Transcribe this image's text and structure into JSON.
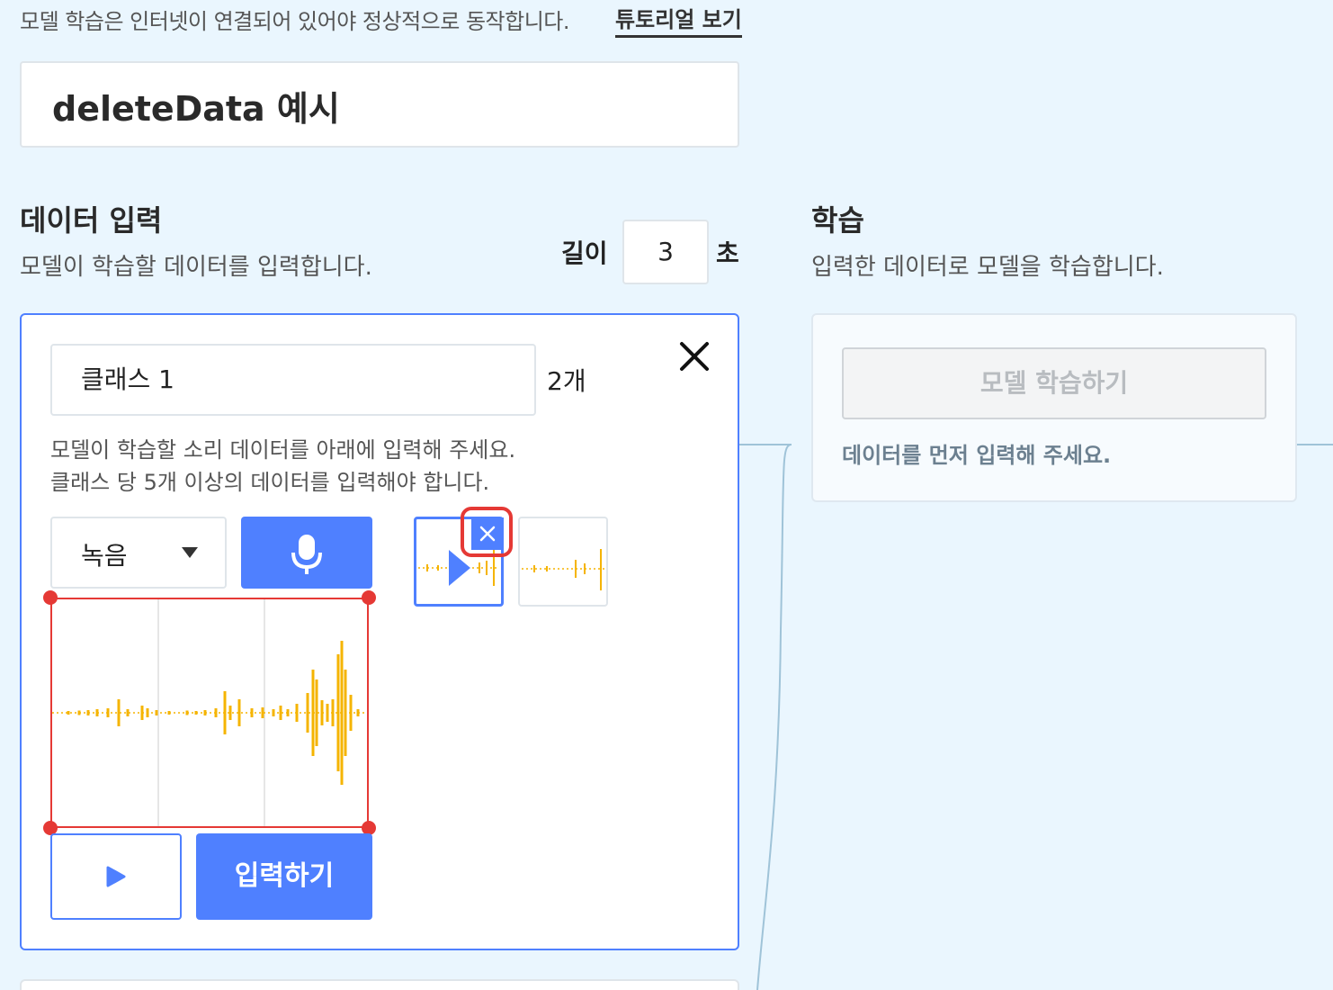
{
  "notice": "모델 학습은 인터넷이 연결되어 있어야 정상적으로 동작합니다.",
  "tutorial_link": "튜토리얼 보기",
  "project_title": "deleteData 예시",
  "data_section": {
    "title": "데이터 입력",
    "description": "모델이 학습할 데이터를 입력합니다.",
    "length_label": "길이",
    "length_value": "3",
    "length_unit": "초"
  },
  "class_card": {
    "name": "클래스 1",
    "count": "2개",
    "instruction_line1": "모델이 학습할 소리 데이터를 아래에 입력해 주세요.",
    "instruction_line2": "클래스 당 5개 이상의 데이터를 입력해야 합니다.",
    "mode": "녹음",
    "input_button": "입력하기",
    "samples_count": 2
  },
  "learn_section": {
    "title": "학습",
    "description": "입력한 데이터로 모델을 학습합니다.",
    "train_button": "모델 학습하기",
    "hint": "데이터를 먼저 입력해 주세요."
  },
  "colors": {
    "accent": "#4f80ff",
    "highlight": "#e53935",
    "waveform": "#f5b400",
    "background": "#eaf6fe"
  },
  "icons": {
    "close": "close-icon",
    "mic": "microphone-icon",
    "play": "play-icon",
    "caret": "caret-down-icon",
    "delete": "delete-x-icon"
  }
}
